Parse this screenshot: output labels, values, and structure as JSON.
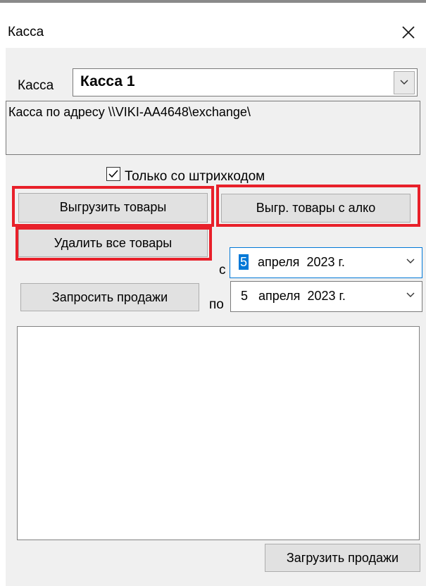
{
  "window": {
    "title": "Касса",
    "close_icon": "close-icon"
  },
  "register": {
    "label": "Касса",
    "selected": "Касса 1",
    "dropdown_icon": "chevron-down-icon",
    "description": "Касса по адресу \\\\VIKI-AA4648\\exchange\\"
  },
  "barcode_only": {
    "label": "Только со штрихкодом",
    "checked": true
  },
  "buttons": {
    "export_goods": "Выгрузить товары",
    "export_goods_alco": "Выгр. товары с алко",
    "delete_all_goods": "Удалить все товары",
    "request_sales": "Запросить продажи",
    "load_sales": "Загрузить продажи"
  },
  "date_range": {
    "from_label": "с",
    "to_label": "по",
    "from": {
      "day": "5",
      "month": "апреля",
      "year": "2023 г."
    },
    "to": {
      "day": "5",
      "month": "апреля",
      "year": "2023 г."
    }
  },
  "colors": {
    "highlight": "#e8202a",
    "selection": "#0078d7",
    "window_bg": "#f0f0f0"
  }
}
